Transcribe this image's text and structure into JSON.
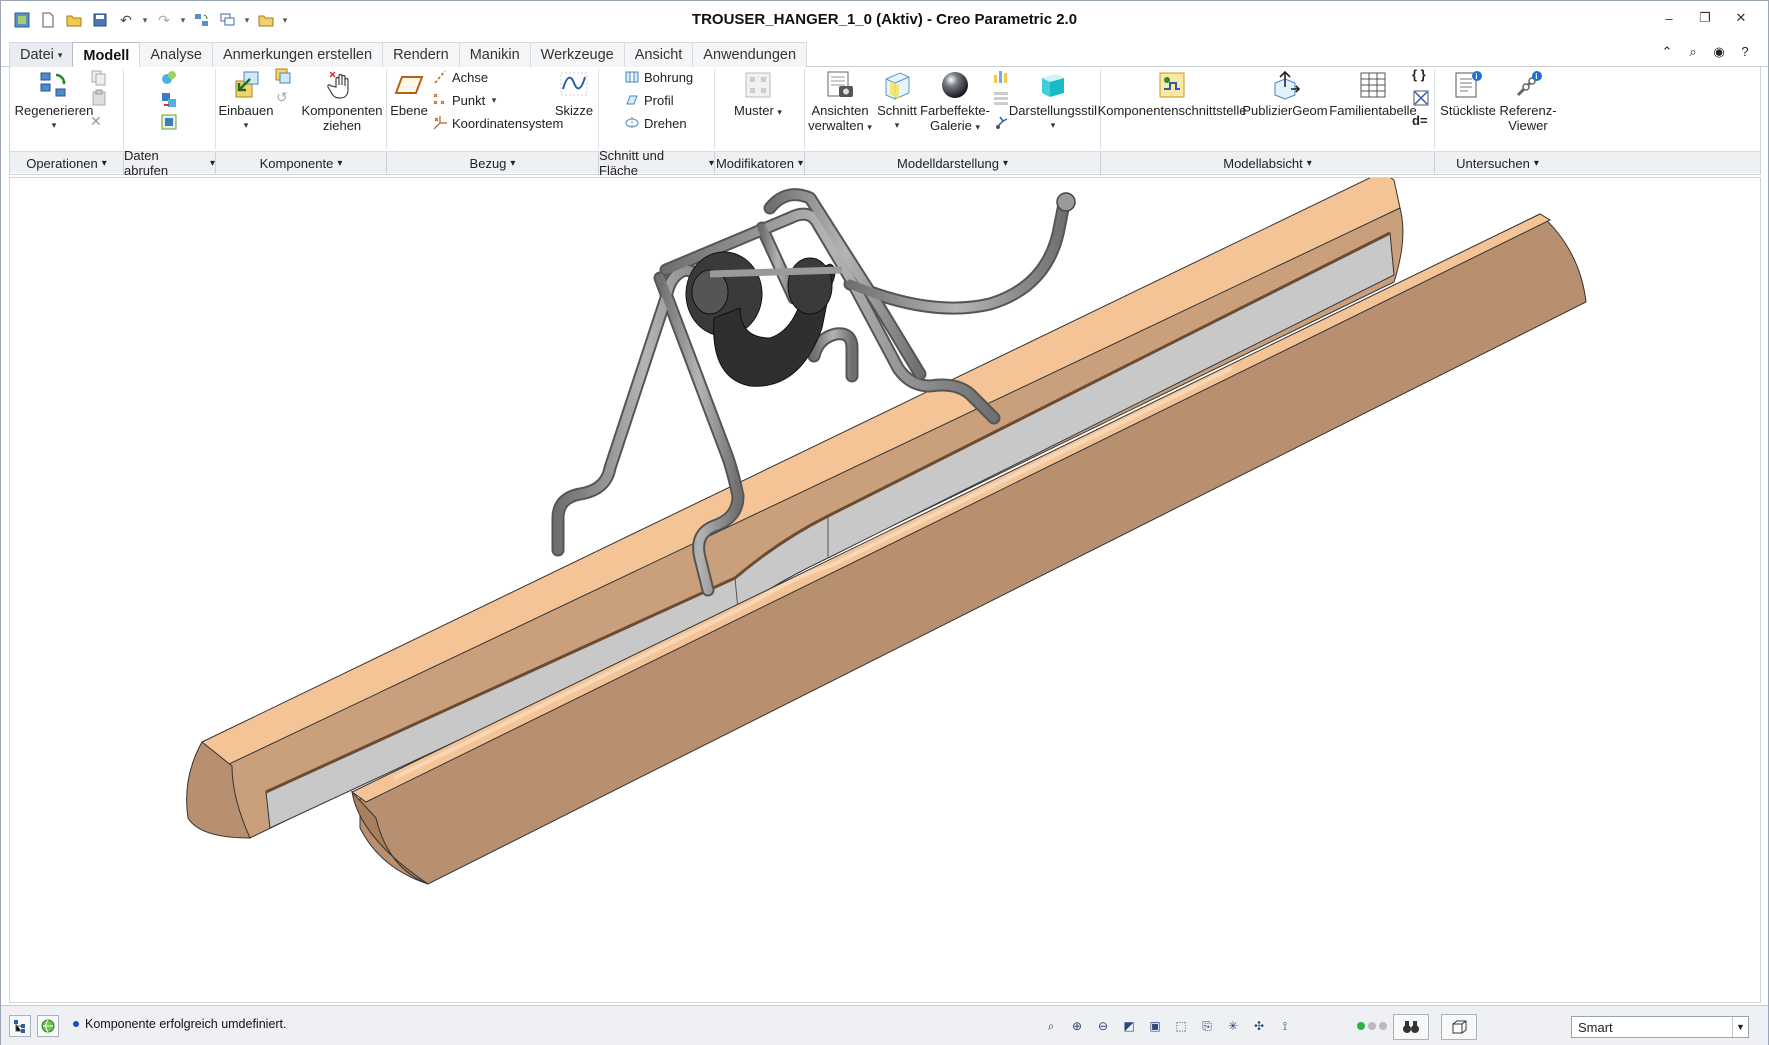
{
  "window": {
    "title": "TROUSER_HANGER_1_0 (Aktiv) - Creo Parametric 2.0"
  },
  "tabs": [
    {
      "label": "Datei"
    },
    {
      "label": "Modell"
    },
    {
      "label": "Analyse"
    },
    {
      "label": "Anmerkungen erstellen"
    },
    {
      "label": "Rendern"
    },
    {
      "label": "Manikin"
    },
    {
      "label": "Werkzeuge"
    },
    {
      "label": "Ansicht"
    },
    {
      "label": "Anwendungen"
    }
  ],
  "ribbon": {
    "operationen": {
      "regenerieren": "Regenerieren"
    },
    "komponente": {
      "einbauen": "Einbauen",
      "komponenten_ziehen_1": "Komponenten",
      "komponenten_ziehen_2": "ziehen"
    },
    "bezug": {
      "ebene": "Ebene",
      "achse": "Achse",
      "punkt": "Punkt",
      "koordinatensystem": "Koordinatensystem",
      "skizze": "Skizze"
    },
    "schnitt": {
      "bohrung": "Bohrung",
      "profil": "Profil",
      "drehen": "Drehen"
    },
    "modifikatoren": {
      "muster": "Muster"
    },
    "modelldarstellung": {
      "ansichten_1": "Ansichten",
      "ansichten_2": "verwalten",
      "schnitt": "Schnitt",
      "farbeffekte_1": "Farbeffekte-",
      "farbeffekte_2": "Galerie",
      "darstellungsstil": "Darstellungsstil"
    },
    "modellabsicht": {
      "komponentenschnittstelle": "Komponentenschnittstelle",
      "publiziergeom": "PublizierGeom",
      "familientabelle": "Familientabelle",
      "d_equals": "d="
    },
    "untersuchen": {
      "stueckliste": "Stückliste",
      "referenz_1": "Referenz-",
      "referenz_2": "Viewer"
    },
    "groups": [
      {
        "label": "Operationen"
      },
      {
        "label": "Daten abrufen"
      },
      {
        "label": "Komponente"
      },
      {
        "label": "Bezug"
      },
      {
        "label": "Schnitt und Fläche"
      },
      {
        "label": "Modifikatoren"
      },
      {
        "label": "Modelldarstellung"
      },
      {
        "label": "Modellabsicht"
      },
      {
        "label": "Untersuchen"
      }
    ]
  },
  "status": {
    "message": "Komponente erfolgreich umdefiniert.",
    "filter_value": "Smart"
  },
  "colors": {
    "wood_top": "#f5c496",
    "wood_side": "#b89070",
    "gray_strip": "#c8c8c8",
    "metal": "#8a8a8a",
    "clip": "#3a3a3a"
  }
}
